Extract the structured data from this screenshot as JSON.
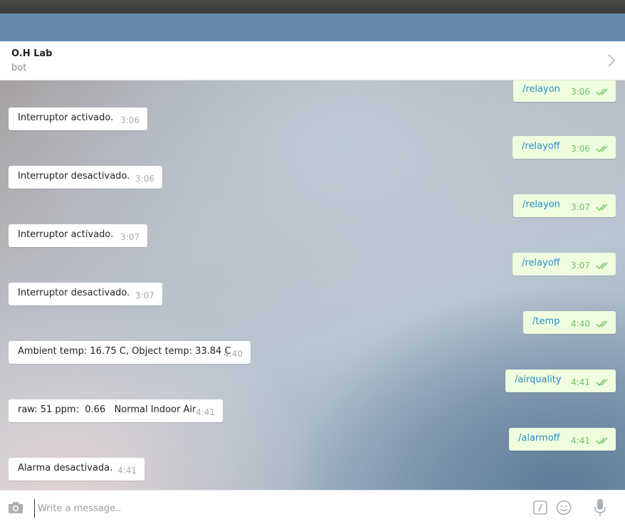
{
  "chat": {
    "name": "O.H Lab",
    "status": "bot"
  },
  "messages": [
    {
      "dir": "out",
      "text": "/relayon",
      "time": "3:06"
    },
    {
      "dir": "in",
      "text": "Interruptor activado.",
      "time": "3:06"
    },
    {
      "dir": "out",
      "text": "/relayoff",
      "time": "3:06"
    },
    {
      "dir": "in",
      "text": "Interruptor desactivado.",
      "time": "3:06"
    },
    {
      "dir": "out",
      "text": "/relayon",
      "time": "3:07"
    },
    {
      "dir": "in",
      "text": "Interruptor activado.",
      "time": "3:07"
    },
    {
      "dir": "out",
      "text": "/relayoff",
      "time": "3:07"
    },
    {
      "dir": "in",
      "text": "Interruptor desactivado.",
      "time": "3:07"
    },
    {
      "dir": "out",
      "text": "/temp",
      "time": "4:40"
    },
    {
      "dir": "in",
      "text": "Ambient temp: 16.75 C, Object temp: 33.84 C",
      "time": "4:40"
    },
    {
      "dir": "out",
      "text": "/airquality",
      "time": "4:41"
    },
    {
      "dir": "in",
      "text": "raw: 51 ppm:  0.66   Normal Indoor Air",
      "time": "4:41"
    },
    {
      "dir": "out",
      "text": "/alarmoff",
      "time": "4:41"
    },
    {
      "dir": "in",
      "text": "Alarma desactivada.",
      "time": "4:41"
    }
  ],
  "composer": {
    "placeholder": "Write a message.."
  },
  "icons": {
    "header_arrow": "chevron-right-icon",
    "read_status": "double-check-icon",
    "attach": "camera-icon",
    "commands": "slash-command-icon",
    "emoji": "emoji-icon",
    "voice": "microphone-icon"
  },
  "colors": {
    "top_band": "#6489ad",
    "outgoing_bubble": "#effdde",
    "outgoing_text": "#2a8cc8",
    "check_marks": "#6cc264",
    "incoming_bubble": "#ffffff"
  }
}
